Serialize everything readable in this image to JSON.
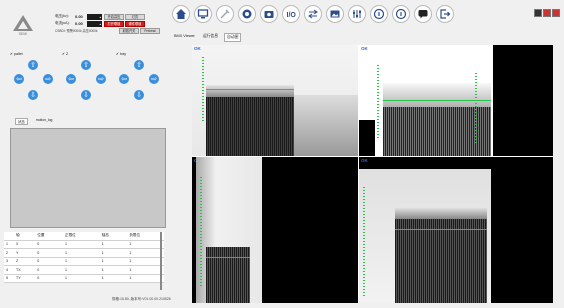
{
  "logo": {
    "text": "SEMI"
  },
  "controls": {
    "rows": [
      {
        "label": "电压(kv):",
        "value": "0.00",
        "buttons": [
          {
            "label": "开启高压",
            "style": "grey"
          },
          {
            "label": "灯亮",
            "style": "grey"
          }
        ]
      },
      {
        "label": "电流(uA):",
        "value": "0.00",
        "buttons": [
          {
            "label": "打开联锁",
            "style": "red"
          },
          {
            "label": "硬件联锁",
            "style": "red"
          }
        ]
      }
    ],
    "status_text": "CSBDI: 预警0000k 高压0000k",
    "row3_buttons": [
      {
        "label": "射线开关",
        "style": "grey"
      },
      {
        "label": "Preheat",
        "style": "grey"
      }
    ]
  },
  "toolbar": {
    "icons": [
      "home-icon",
      "monitor-icon",
      "tools-icon",
      "record-icon",
      "camera-icon",
      "io-icon",
      "transfer-icon",
      "image-icon",
      "settings-sliders-icon",
      "info-circle-icon",
      "info-circle-2-icon",
      "chat-icon",
      "logout-icon"
    ]
  },
  "tabs": [
    "BMX Viewer",
    "运行信息",
    "自动图"
  ],
  "axes": {
    "pallet": {
      "label": "pallet",
      "checked": true
    },
    "z": {
      "label": "Z",
      "checked": true
    },
    "tray": {
      "label": "tray",
      "checked": true
    }
  },
  "subtabs": [
    "状态",
    "motion_log"
  ],
  "table": {
    "headers": [
      "轴",
      "位置",
      "正限位",
      "轴态",
      "负限位"
    ],
    "rows": [
      [
        "1",
        "X",
        "0",
        "1",
        "1",
        "1"
      ],
      [
        "2",
        "Y",
        "0",
        "1",
        "1",
        "1"
      ],
      [
        "3",
        "Z",
        "0",
        "1",
        "1",
        "1"
      ],
      [
        "4",
        "TX",
        "0",
        "1",
        "1",
        "1"
      ],
      [
        "5",
        "TY",
        "0",
        "1",
        "1",
        "1"
      ]
    ]
  },
  "footer": {
    "text": "规格:15.80, 版本号:V01.00.00.210526"
  },
  "viewer": {
    "panels": [
      {
        "status": "OK"
      },
      {
        "status": "OK"
      },
      {
        "status": "OK"
      },
      {
        "status": "OK"
      }
    ]
  }
}
